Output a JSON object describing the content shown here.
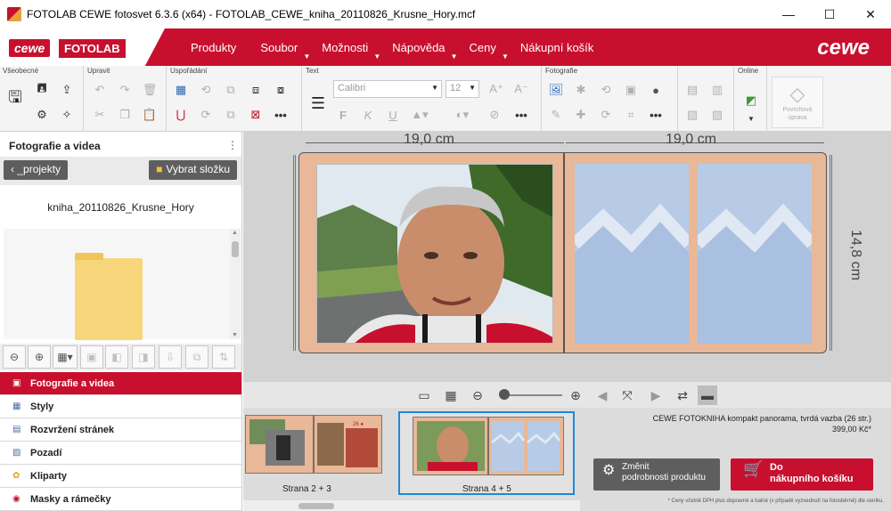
{
  "window": {
    "title": "FOTOLAB CEWE fotosvet 6.3.6 (x64) - FOTOLAB_CEWE_kniha_20110826_Krusne_Hory.mcf",
    "minimize": "—",
    "maximize": "☐",
    "close": "✕"
  },
  "brand": {
    "cewe": "cewe",
    "fotolab": "FOTOLAB",
    "right_logo": "cewe"
  },
  "menu": [
    {
      "label": "Produkty"
    },
    {
      "label": "Soubor"
    },
    {
      "label": "Možnosti"
    },
    {
      "label": "Nápověda"
    },
    {
      "label": "Ceny"
    },
    {
      "label": "Nákupní košík"
    }
  ],
  "ribbon": {
    "groups": {
      "general": "Všeobecné",
      "edit": "Upravit",
      "arrange": "Uspořádání",
      "text": "Text",
      "photos": "Fotografie",
      "online": "Online"
    },
    "font_value": "Calibri",
    "font_size": "12",
    "text_bold": "F",
    "text_italic": "K",
    "text_underline": "U",
    "more": "•••",
    "diamond_label_1": "Povrchová",
    "diamond_label_2": "úprava"
  },
  "left_panel": {
    "title": "Fotografie a videa",
    "back_button": "_projekty",
    "folder_button": "Vybrat složku",
    "folder_name": "kniha_20110826_Krusne_Hory",
    "categories": [
      {
        "label": "Fotografie a videa",
        "active": true
      },
      {
        "label": "Styly",
        "active": false
      },
      {
        "label": "Rozvržení stránek",
        "active": false
      },
      {
        "label": "Pozadí",
        "active": false
      },
      {
        "label": "Kliparty",
        "active": false
      },
      {
        "label": "Masky a rámečky",
        "active": false
      }
    ]
  },
  "canvas": {
    "width_left": "19,0 cm",
    "width_right": "19,0 cm",
    "height": "14,8 cm"
  },
  "pages": [
    {
      "label": "Strana 2 + 3",
      "selected": false
    },
    {
      "label": "Strana 4 + 5",
      "selected": true
    }
  ],
  "product": {
    "name": "CEWE FOTOKNIHA kompakt panorama, tvrdá vazba (26 str.)",
    "price": "399,00 Kč*",
    "change_line1": "Změnit",
    "change_line2": "podrobnosti produktu",
    "cart_line1": "Do",
    "cart_line2": "nákupního košíku",
    "footnote": "* Ceny včetně DPH plus dopravné a balné (v případě vyzvednutí na fotosběrně) dle ceníku."
  },
  "colors": {
    "accent": "#c8102e",
    "selection": "#1e88d8",
    "page_bg": "#e8b898",
    "placeholder": "#b7cbe6"
  }
}
